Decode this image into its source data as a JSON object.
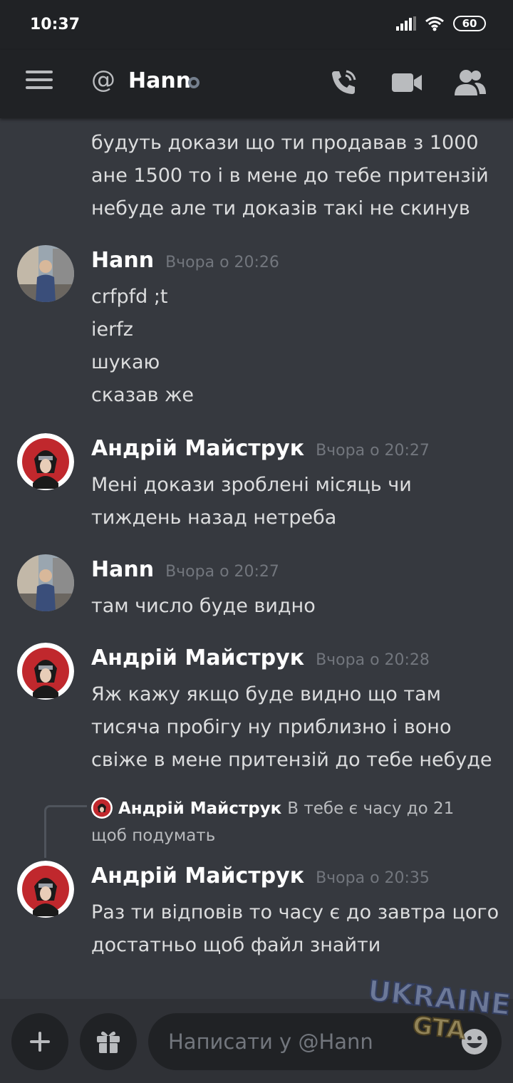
{
  "status_bar": {
    "time": "10:37",
    "battery": "60"
  },
  "header": {
    "recipient": "Hann",
    "icons": [
      "menu-icon",
      "at-icon",
      "call-icon",
      "video-icon",
      "members-icon"
    ]
  },
  "top_continuation": [
    "будуть докази що ти продавав з 1000",
    "ане 1500 то і в мене до тебе притензій",
    "небуде але ти доказів такі не скинув"
  ],
  "messages": [
    {
      "author": "Hann",
      "timestamp": "Вчора о 20:26",
      "lines": [
        "crfpfd ;t",
        "ierfz",
        "шукаю",
        "сказав же"
      ]
    },
    {
      "author": "Андрій Майструк",
      "timestamp": "Вчора о 20:27",
      "lines": [
        "Мені докази зроблені місяць чи",
        "тиждень назад нетреба"
      ]
    },
    {
      "author": "Hann",
      "timestamp": "Вчора о 20:27",
      "lines": [
        "там число буде видно"
      ]
    },
    {
      "author": "Андрій Майструк",
      "timestamp": "Вчора о 20:28",
      "lines": [
        "Яж кажу якщо буде видно що там",
        "тисяча пробігу ну приблизно і воно",
        "свіже в мене притензій до тебе небуде"
      ]
    },
    {
      "author": "Андрій Майструк",
      "timestamp": "Вчора о 20:35",
      "lines": [
        "Раз ти відповів то часу є до завтра цого",
        "достатньо щоб файл знайти"
      ]
    }
  ],
  "reply": {
    "author": "Андрій Майструк",
    "text": "В тебе є часу до 21 щоб подумать"
  },
  "composer": {
    "placeholder": "Написати у @Hann"
  },
  "watermark": {
    "line1": "UKRAINE",
    "line2": "GTA"
  }
}
